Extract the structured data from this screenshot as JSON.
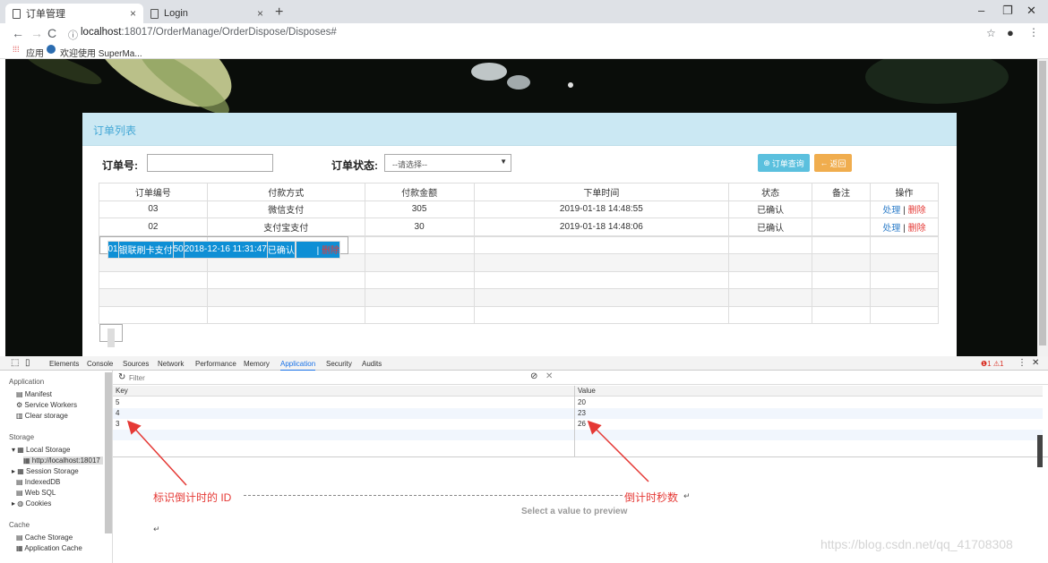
{
  "browser": {
    "tabs": [
      {
        "title": "订单管理",
        "close": "×"
      },
      {
        "title": "Login",
        "close": "×"
      }
    ],
    "new_tab": "+",
    "window_controls": [
      "–",
      "❐",
      "✕"
    ],
    "url_host": "localhost",
    "url_rest": ":18017/OrderManage/OrderDispose/Disposes#",
    "bookmarks": [
      {
        "label": "应用"
      },
      {
        "label": "欢迎使用 SuperMa..."
      }
    ]
  },
  "page": {
    "panel_title": "订单列表",
    "order_no_label": "订单号:",
    "order_no_value": "",
    "status_label": "订单状态:",
    "status_selected": "--请选择--",
    "query_button": "订单查询",
    "back_button": "返回",
    "columns": [
      "订单编号",
      "付款方式",
      "付款金额",
      "下单时间",
      "状态",
      "备注",
      "操作"
    ],
    "orders": [
      {
        "id": "03",
        "pay": "微信支付",
        "amount": "305",
        "time": "2019-01-18 14:48:55",
        "status": "已确认",
        "note": "",
        "handle": "处理",
        "sep": "|",
        "del": "删除"
      },
      {
        "id": "02",
        "pay": "支付宝支付",
        "amount": "30",
        "time": "2019-01-18 14:48:06",
        "status": "已确认",
        "note": "",
        "handle": "处理",
        "sep": "|",
        "del": "删除"
      },
      {
        "id": "01",
        "pay": "银联刷卡支付",
        "amount": "50",
        "time": "2018-12-16 11:31:47",
        "status": "已确认",
        "note": "",
        "handle": "处理",
        "sep": "|",
        "del": "删除"
      }
    ]
  },
  "devtools": {
    "tabs": [
      "Elements",
      "Console",
      "Sources",
      "Network",
      "Performance",
      "Memory",
      "Application",
      "Security",
      "Audits"
    ],
    "active_tab": "Application",
    "status": "❶1 ⚠1",
    "sidebar": {
      "application_header": "Application",
      "application_items": [
        "Manifest",
        "Service Workers",
        "Clear storage"
      ],
      "storage_header": "Storage",
      "storage_items": [
        "Local Storage",
        "http://localhost:18017",
        "Session Storage",
        "IndexedDB",
        "Web SQL",
        "Cookies"
      ],
      "cache_header": "Cache",
      "cache_items": [
        "Cache Storage",
        "Application Cache"
      ]
    },
    "filter_placeholder": "Filter",
    "key_header": "Key",
    "value_header": "Value",
    "rows": [
      {
        "key": "5",
        "value": "20"
      },
      {
        "key": "4",
        "value": "23"
      },
      {
        "key": "3",
        "value": "26"
      }
    ],
    "preview_text": "Select a value to preview",
    "annotation_left": "标识倒计时的 ID",
    "annotation_right": "倒计时秒数",
    "return_mark": "↵",
    "watermark": "https://blog.csdn.net/qq_41708308"
  }
}
